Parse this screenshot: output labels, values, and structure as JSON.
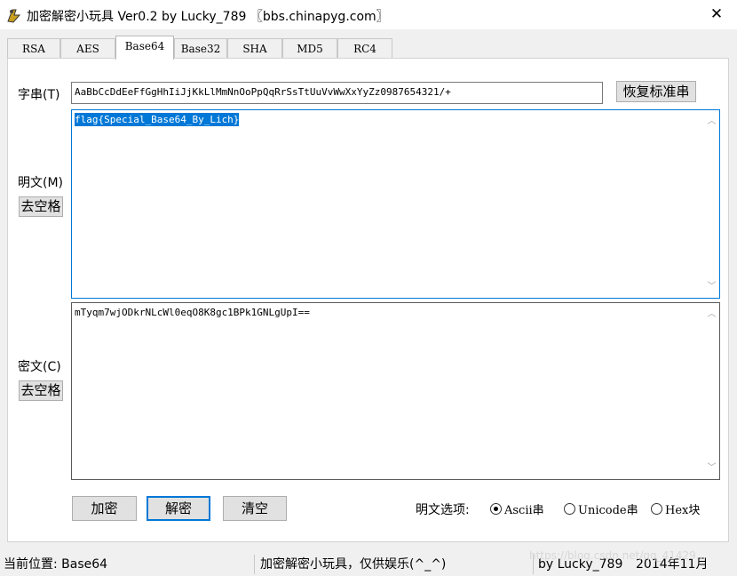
{
  "window": {
    "title": "加密解密小玩具 Ver0.2 by Lucky_789 〖bbs.chinapyg.com〗",
    "close_glyph": "✕"
  },
  "tabs": [
    {
      "label": "RSA",
      "active": false
    },
    {
      "label": "AES",
      "active": false
    },
    {
      "label": "Base64",
      "active": true
    },
    {
      "label": "Base32",
      "active": false
    },
    {
      "label": "SHA",
      "active": false
    },
    {
      "label": "MD5",
      "active": false
    },
    {
      "label": "RC4",
      "active": false
    }
  ],
  "charset": {
    "label": "字串(T)",
    "value": "AaBbCcDdEeFfGgHhIiJjKkLlMmNnOoPpQqRrSsTtUuVvWwXxYyZz0987654321/+",
    "restore_button": "恢复标准串"
  },
  "plaintext": {
    "label": "明文(M)",
    "strip_button": "去空格",
    "value": "flag{Special_Base64_By_Lich}"
  },
  "ciphertext": {
    "label": "密文(C)",
    "strip_button": "去空格",
    "value": "mTyqm7wjODkrNLcWl0eqO8K8gc1BPk1GNLgUpI=="
  },
  "actions": {
    "encrypt": "加密",
    "decrypt": "解密",
    "clear": "清空"
  },
  "plaintext_options": {
    "label": "明文选项:",
    "options": [
      {
        "label": "Ascii串",
        "selected": true
      },
      {
        "label": "Unicode串",
        "selected": false
      },
      {
        "label": "Hex块",
        "selected": false
      }
    ]
  },
  "statusbar": {
    "position": "当前位置: Base64",
    "message": "加密解密小玩具，仅供娱乐(^_^)",
    "author": "by Lucky_789",
    "date": "2014年11月"
  },
  "watermark": "https://blog.csdn.net/qq_41429..."
}
